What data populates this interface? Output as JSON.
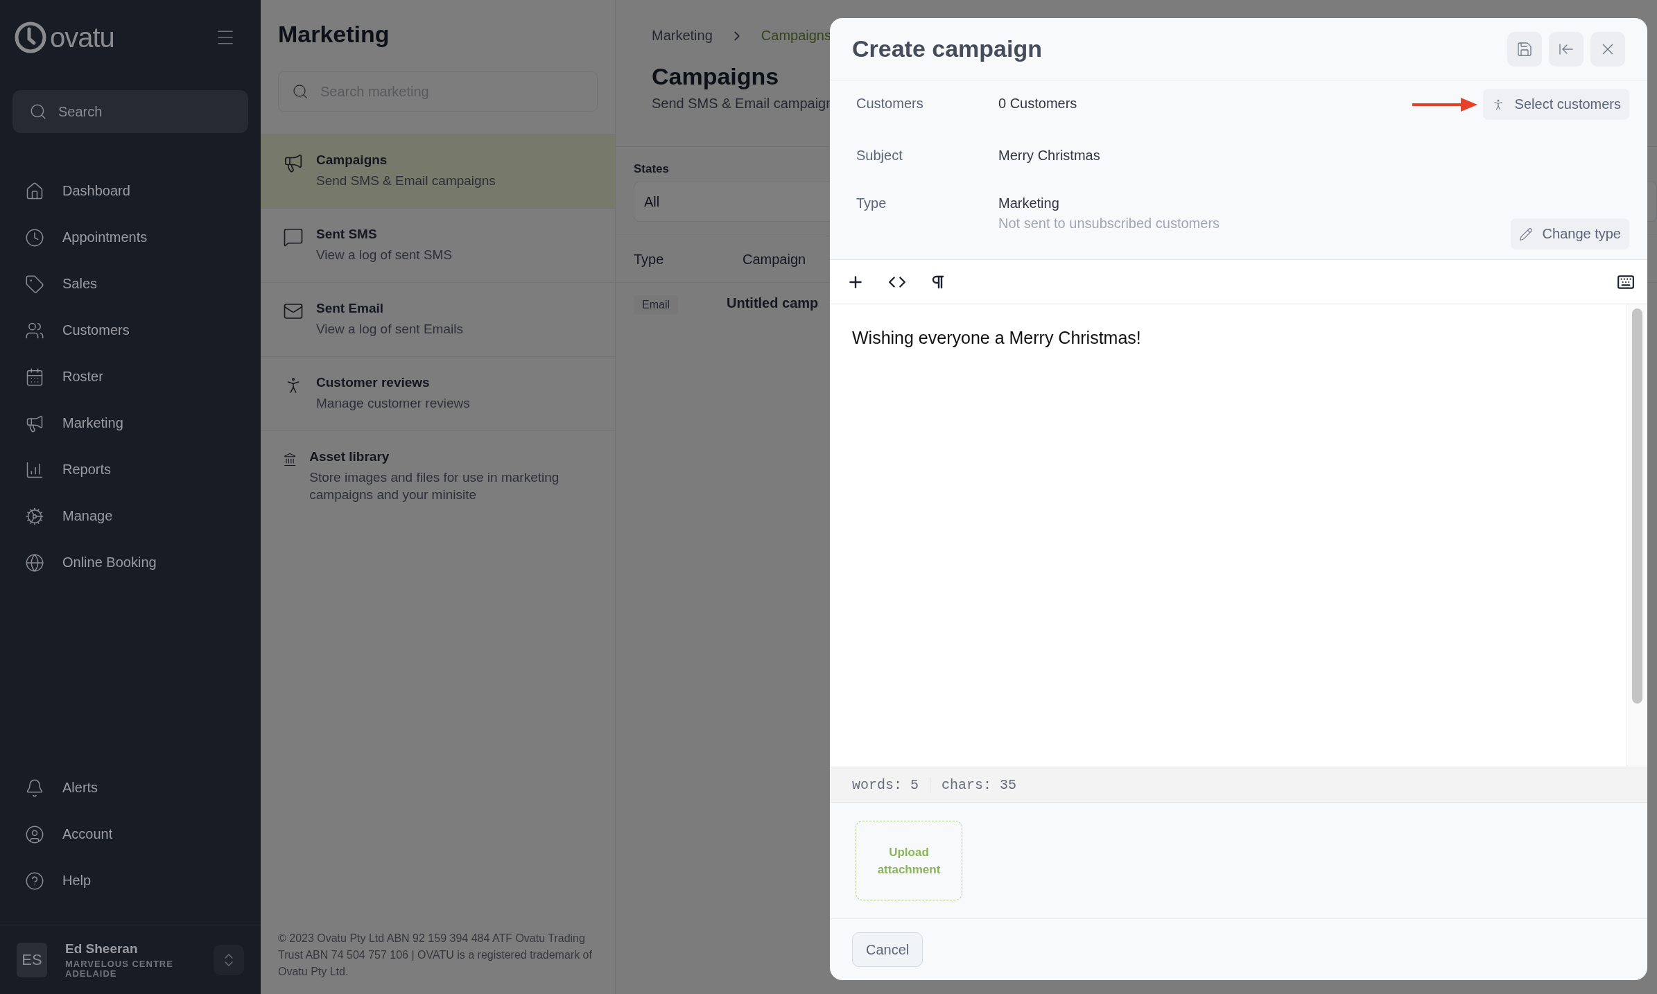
{
  "sidebar": {
    "logo": "ovatu",
    "search": {
      "placeholder": "Search"
    },
    "nav_items": [
      {
        "label": "Dashboard"
      },
      {
        "label": "Appointments"
      },
      {
        "label": "Sales"
      },
      {
        "label": "Customers"
      },
      {
        "label": "Roster"
      },
      {
        "label": "Marketing"
      },
      {
        "label": "Reports"
      },
      {
        "label": "Manage"
      },
      {
        "label": "Online Booking"
      }
    ],
    "bottom_items": [
      {
        "label": "Alerts"
      },
      {
        "label": "Account"
      },
      {
        "label": "Help"
      }
    ],
    "user": {
      "initials": "ES",
      "name": "Ed Sheeran",
      "location": "MARVELOUS CENTRE ADELAIDE"
    }
  },
  "marketing_panel": {
    "title": "Marketing",
    "search": {
      "placeholder": "Search marketing"
    },
    "items": [
      {
        "title": "Campaigns",
        "description": "Send SMS & Email campaigns",
        "selected": true
      },
      {
        "title": "Sent SMS",
        "description": "View a log of sent SMS",
        "selected": false
      },
      {
        "title": "Sent Email",
        "description": "View a log of sent Emails",
        "selected": false
      },
      {
        "title": "Customer reviews",
        "description": "Manage customer reviews",
        "selected": false
      },
      {
        "title": "Asset library",
        "description": "Store images and files for use in marketing campaigns and your minisite",
        "selected": false
      }
    ],
    "footer": "© 2023 Ovatu Pty Ltd ABN 92 159 394 484 ATF Ovatu Trading Trust ABN 74 504 757 106 | OVATU is a registered trademark of Ovatu Pty Ltd."
  },
  "main": {
    "breadcrumbs": [
      {
        "label": "Marketing",
        "current": false
      },
      {
        "label": "Campaigns",
        "current": true
      }
    ],
    "title": "Campaigns",
    "subtitle": "Send SMS & Email campaign",
    "filter": {
      "label": "States",
      "value": "All"
    },
    "table": {
      "columns": [
        "Type",
        "Campaign"
      ],
      "rows": [
        {
          "type": "Email",
          "campaign": "Untitled camp"
        }
      ]
    }
  },
  "dialog": {
    "title": "Create campaign",
    "fields": [
      {
        "label": "Customers",
        "value": "0 Customers",
        "action": "Select customers"
      },
      {
        "label": "Subject",
        "value": "Merry Christmas"
      },
      {
        "label": "Type",
        "value": "Marketing",
        "note": "Not sent to unsubscribed customers",
        "action": "Change type"
      }
    ],
    "editor": {
      "content": "Wishing everyone a Merry Christmas!",
      "words": "words: 5",
      "chars": "chars: 35"
    },
    "upload": "Upload attachment",
    "buttons": [
      "Cancel"
    ]
  }
}
